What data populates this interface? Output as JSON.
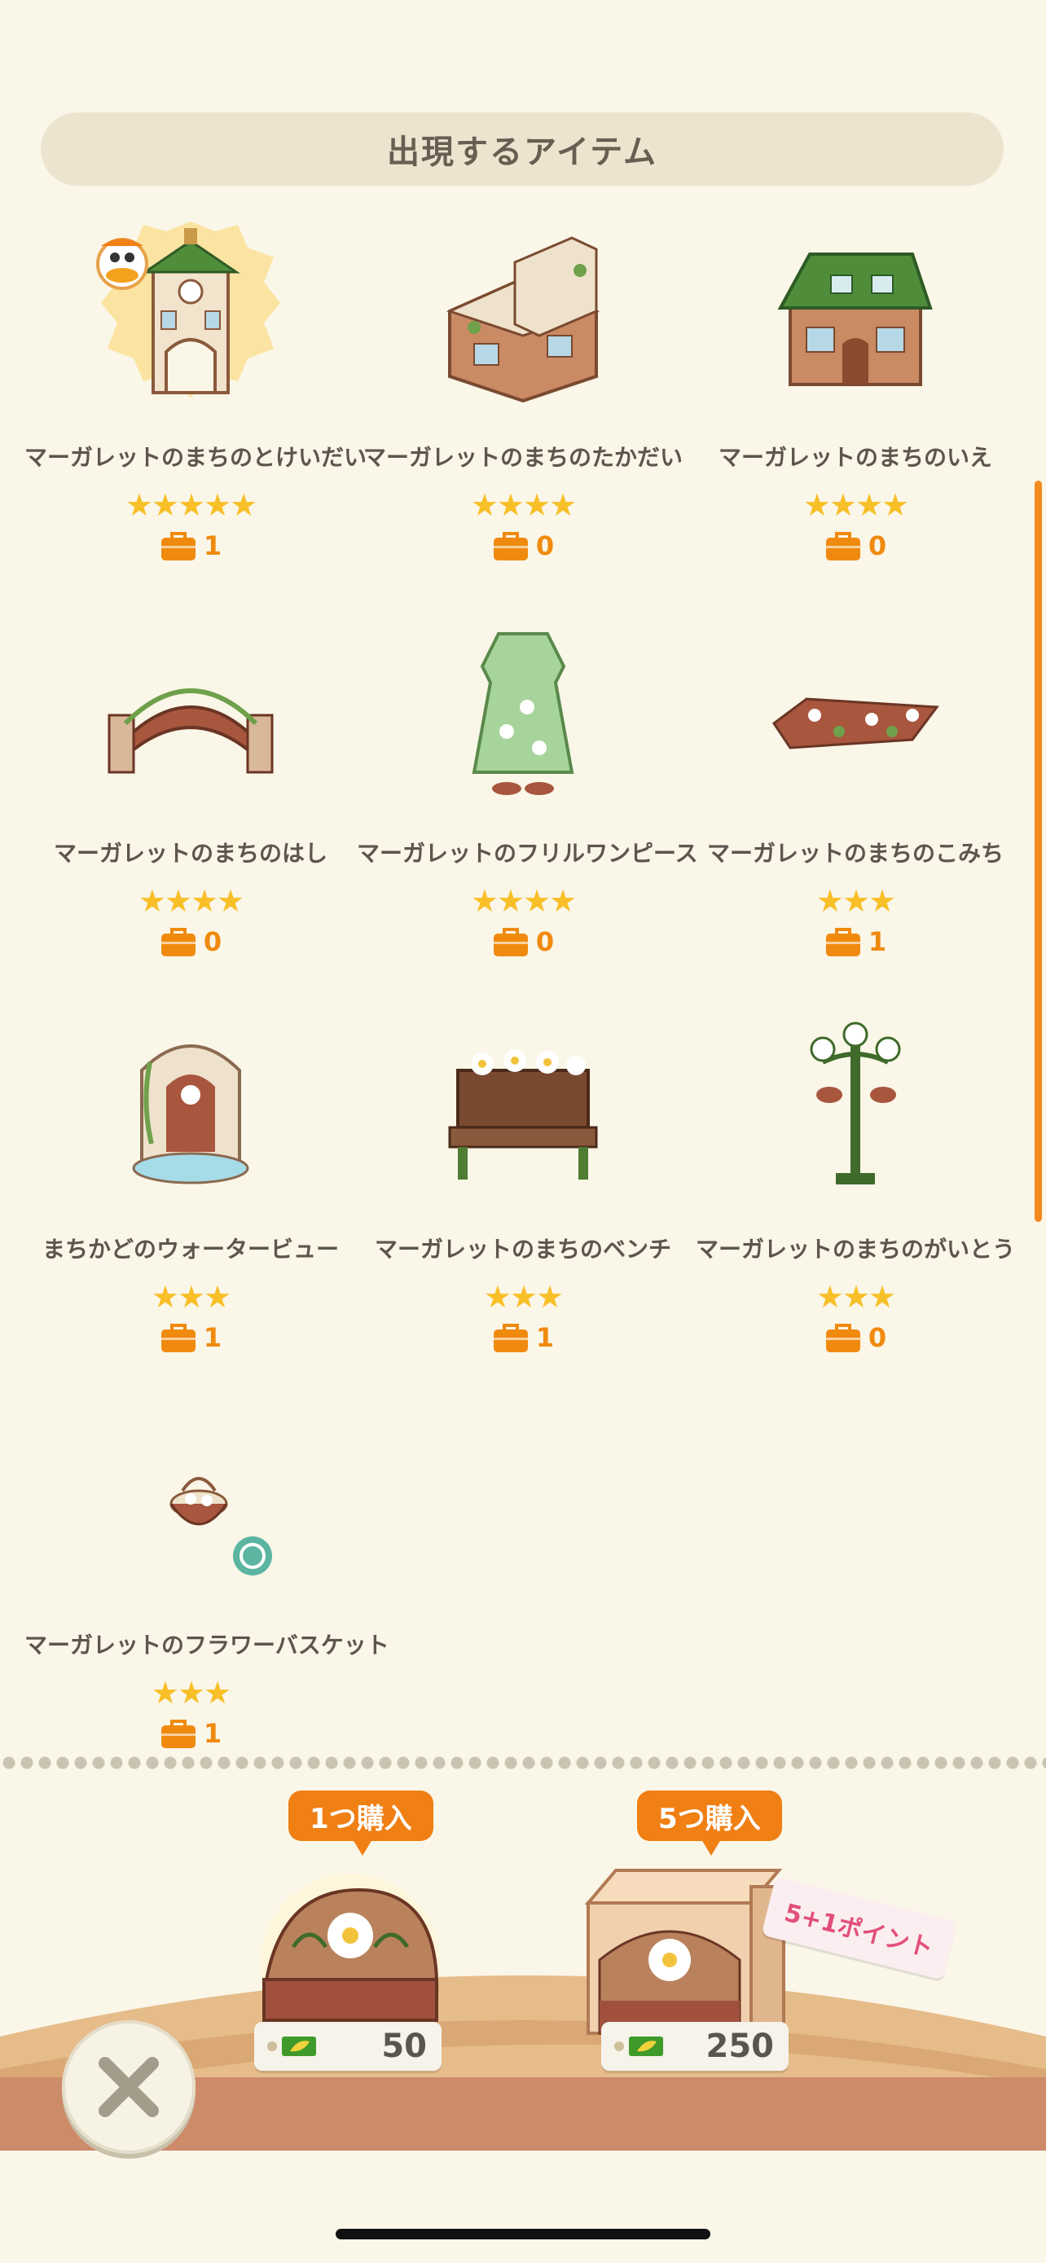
{
  "header": {
    "title": "出現するアイテム"
  },
  "items": [
    {
      "name": "マーガレットのまちのとけいだい",
      "stars": "★★★★★",
      "count": "1",
      "icon": "clock-tower-icon"
    },
    {
      "name": "マーガレットのまちのたかだい",
      "stars": "★★★★",
      "count": "0",
      "icon": "terrace-icon"
    },
    {
      "name": "マーガレットのまちのいえ",
      "stars": "★★★★",
      "count": "0",
      "icon": "house-icon"
    },
    {
      "name": "マーガレットのまちのはし",
      "stars": "★★★★",
      "count": "0",
      "icon": "bridge-icon"
    },
    {
      "name": "マーガレットのフリルワンピース",
      "stars": "★★★★",
      "count": "0",
      "icon": "dress-icon"
    },
    {
      "name": "マーガレットのまちのこみち",
      "stars": "★★★",
      "count": "1",
      "icon": "path-icon"
    },
    {
      "name": "まちかどのウォータービュー",
      "stars": "★★★",
      "count": "1",
      "icon": "fountain-icon"
    },
    {
      "name": "マーガレットのまちのベンチ",
      "stars": "★★★",
      "count": "1",
      "icon": "bench-icon"
    },
    {
      "name": "マーガレットのまちのがいとう",
      "stars": "★★★",
      "count": "0",
      "icon": "streetlamp-icon"
    },
    {
      "name": "マーガレットのフラワーバスケット",
      "stars": "★★★",
      "count": "1",
      "icon": "flower-basket-icon"
    }
  ],
  "purchase": {
    "single": {
      "label": "1つ購入",
      "price": "50"
    },
    "five": {
      "label": "5つ購入",
      "price": "250",
      "bonus": "5+1ポイント"
    }
  },
  "colors": {
    "accent": "#f07f14",
    "star": "#f8bf28",
    "background": "#faf6e8"
  }
}
